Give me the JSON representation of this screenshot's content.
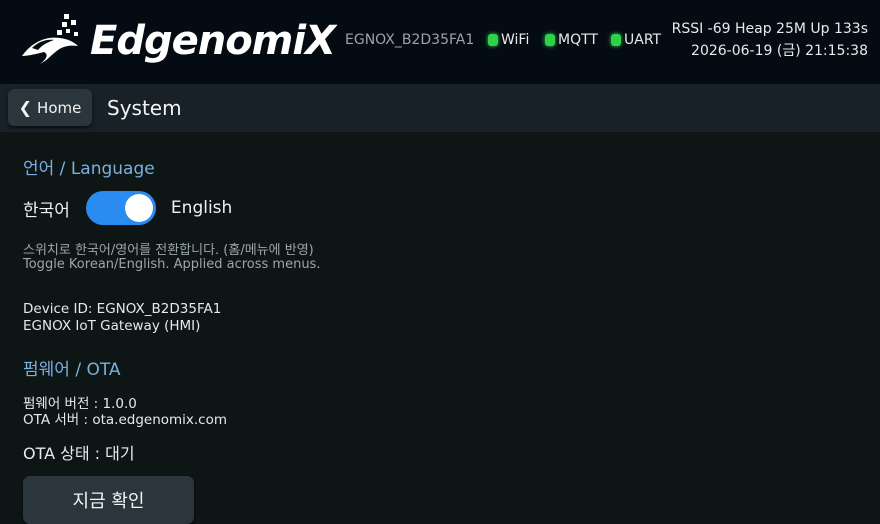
{
  "header": {
    "brand": "EdgenomiX",
    "device_id": "EGNOX_B2D35FA1",
    "status": [
      {
        "label": "WiFi",
        "color": "#2fd04a"
      },
      {
        "label": "MQTT",
        "color": "#2fd04a"
      },
      {
        "label": "UART",
        "color": "#2fd04a"
      }
    ],
    "system_line": "RSSI -69  Heap 25M  Up 133s",
    "datetime": "2026-06-19 (금) 21:15:38"
  },
  "nav": {
    "home_label": "Home",
    "page_title": "System"
  },
  "language": {
    "heading": "언어 / Language",
    "left_label": "한국어",
    "right_label": "English",
    "toggle_on": true,
    "hint_ko": "스위치로 한국어/영어를 전환합니다. (홈/메뉴에 반영)",
    "hint_en": "Toggle Korean/English. Applied across menus."
  },
  "device": {
    "id_line": "Device ID: EGNOX_B2D35FA1",
    "desc_line": "EGNOX IoT Gateway (HMI)"
  },
  "ota": {
    "heading": "펌웨어 / OTA",
    "version_line": "펌웨어 버전 :  1.0.0",
    "server_line": "OTA 서버 :  ota.edgenomix.com",
    "state_line": "OTA 상태 :  대기",
    "check_button": "지금 확인"
  },
  "colors": {
    "accent": "#2a8cf0",
    "heading": "#7ab0e0",
    "led": "#2fd04a"
  }
}
